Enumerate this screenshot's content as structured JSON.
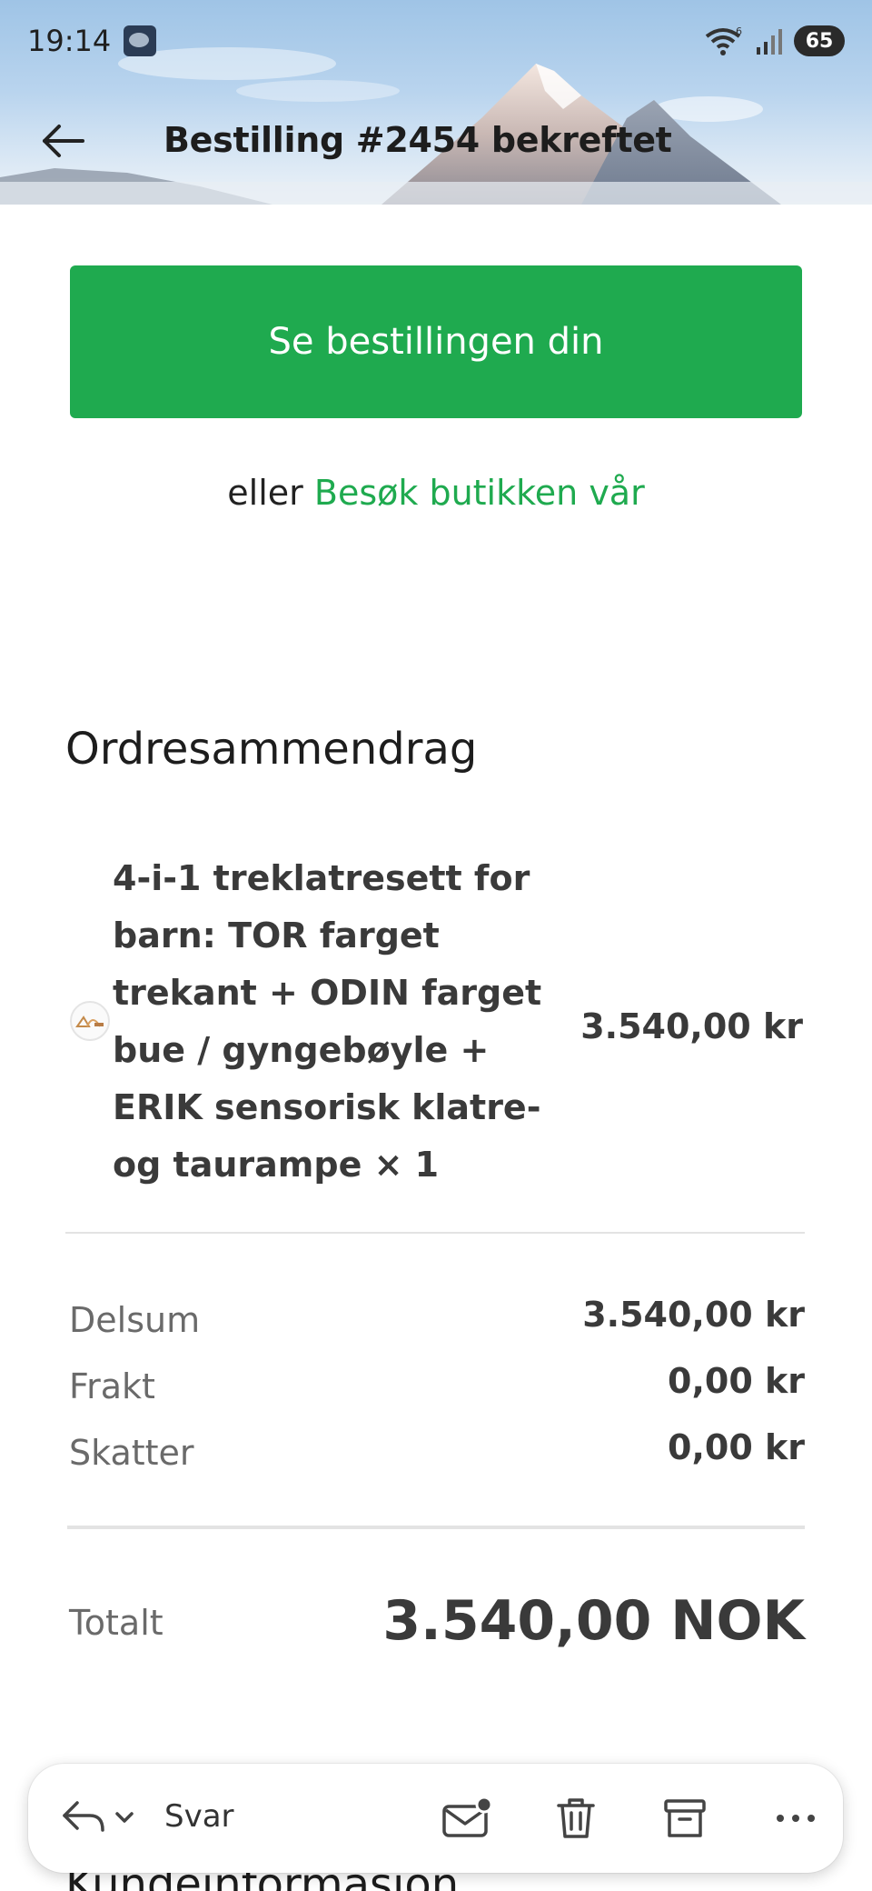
{
  "status_bar": {
    "time": "19:14",
    "wifi_badge": "6",
    "battery": "65"
  },
  "header": {
    "back_icon": "arrow-left-icon",
    "title": "Bestilling #2454 bekreftet"
  },
  "cta": {
    "primary_label": "Se bestillingen din",
    "alt_prefix": "eller",
    "alt_link": "Besøk butikken vår",
    "accent_color": "#1faa4f"
  },
  "order_summary": {
    "title": "Ordresammendrag",
    "items": [
      {
        "name": "4-i-1 treklatresett for barn: TOR farget trekant + ODIN farget bue / gyngebøyle + ERIK sensorisk klatre- og taurampe × 1",
        "price": "3.540,00 kr"
      }
    ],
    "subtotal_label": "Delsum",
    "subtotal_value": "3.540,00 kr",
    "shipping_label": "Frakt",
    "shipping_value": "0,00 kr",
    "taxes_label": "Skatter",
    "taxes_value": "0,00 kr",
    "total_label": "Totalt",
    "total_value": "3.540,00 NOK"
  },
  "next_section_title": "Kundeinformasjon",
  "toolbar": {
    "reply_label": "Svar",
    "icons": [
      "reply-icon",
      "chevron-down-icon",
      "mark-unread-icon",
      "trash-icon",
      "archive-icon",
      "more-icon"
    ]
  }
}
